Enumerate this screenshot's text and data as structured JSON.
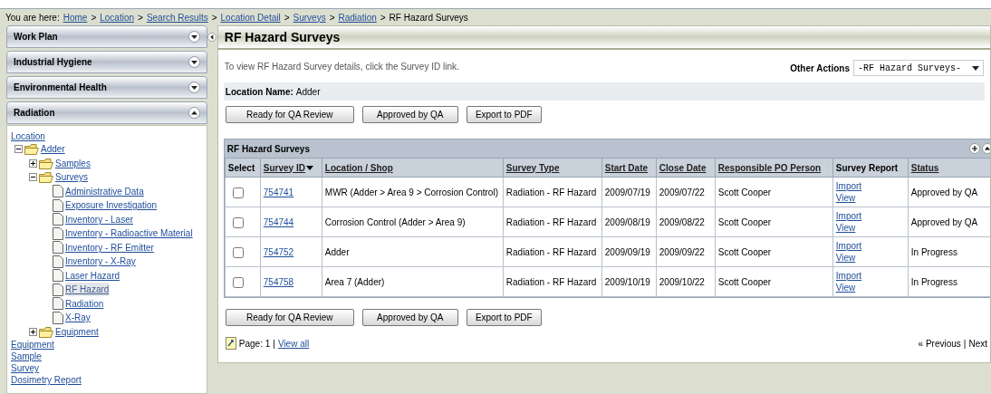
{
  "breadcrumb": {
    "prefix": "You are here:",
    "links": [
      "Home",
      "Location",
      "Search Results",
      "Location Detail",
      "Surveys",
      "Radiation"
    ],
    "separator": ">",
    "current": "RF Hazard Surveys"
  },
  "sidebar": {
    "panels": [
      {
        "label": "Work Plan",
        "expanded": false
      },
      {
        "label": "Industrial Hygiene",
        "expanded": false
      },
      {
        "label": "Environmental Health",
        "expanded": false
      },
      {
        "label": "Radiation",
        "expanded": true
      }
    ],
    "tree": {
      "root": "Location",
      "children": [
        {
          "label": "Adder",
          "kind": "folder",
          "expanded": true,
          "children": [
            {
              "label": "Samples",
              "kind": "folder",
              "expanded": false
            },
            {
              "label": "Surveys",
              "kind": "folder",
              "expanded": true,
              "children": [
                {
                  "label": "Administrative Data",
                  "kind": "page",
                  "selected": false
                },
                {
                  "label": "Exposure Investigation",
                  "kind": "page",
                  "selected": false
                },
                {
                  "label": "Inventory - Laser",
                  "kind": "page",
                  "selected": false
                },
                {
                  "label": "Inventory - Radioactive Material",
                  "kind": "page",
                  "selected": false
                },
                {
                  "label": "Inventory - RF Emitter",
                  "kind": "page",
                  "selected": false
                },
                {
                  "label": "Inventory - X-Ray",
                  "kind": "page",
                  "selected": false
                },
                {
                  "label": "Laser Hazard",
                  "kind": "page",
                  "selected": false
                },
                {
                  "label": "RF Hazard",
                  "kind": "page",
                  "selected": true
                },
                {
                  "label": "Radiation",
                  "kind": "page",
                  "selected": false
                },
                {
                  "label": "X-Ray",
                  "kind": "page",
                  "selected": false
                }
              ]
            },
            {
              "label": "Equipment",
              "kind": "folder",
              "expanded": false
            }
          ]
        }
      ]
    },
    "links": [
      "Equipment",
      "Sample",
      "Survey",
      "Dosimetry Report"
    ]
  },
  "main": {
    "title": "RF Hazard Surveys",
    "instructions": "To view RF Hazard Survey details, click the Survey ID link.",
    "other_actions": {
      "label": "Other Actions",
      "value": "-RF Hazard Surveys-"
    },
    "location_name": {
      "label": "Location Name:",
      "value": "Adder"
    },
    "buttons": [
      "Ready for QA Review",
      "Approved by QA",
      "Export to PDF"
    ],
    "table": {
      "title": "RF Hazard Surveys",
      "columns": [
        {
          "label": "Select",
          "sortable": false,
          "sorted": false
        },
        {
          "label": "Survey ID",
          "sortable": true,
          "sorted": true
        },
        {
          "label": "Location / Shop",
          "sortable": true,
          "sorted": false
        },
        {
          "label": "Survey Type",
          "sortable": true,
          "sorted": false
        },
        {
          "label": "Start Date",
          "sortable": true,
          "sorted": false
        },
        {
          "label": "Close Date",
          "sortable": true,
          "sorted": false
        },
        {
          "label": "Responsible PO Person",
          "sortable": true,
          "sorted": false
        },
        {
          "label": "Survey Report",
          "sortable": false,
          "sorted": false
        },
        {
          "label": "Status",
          "sortable": true,
          "sorted": false
        }
      ],
      "rows": [
        {
          "checked": false,
          "id": "754741",
          "location": "MWR (Adder > Area 9 > Corrosion Control)",
          "type": "Radiation - RF Hazard",
          "start": "2009/07/19",
          "close": "2009/07/22",
          "person": "Scott Cooper",
          "report_links": [
            "Import",
            "View"
          ],
          "status": "Approved by QA"
        },
        {
          "checked": false,
          "id": "754744",
          "location": "Corrosion Control (Adder > Area 9)",
          "type": "Radiation - RF Hazard",
          "start": "2009/08/19",
          "close": "2009/08/22",
          "person": "Scott Cooper",
          "report_links": [
            "Import",
            "View"
          ],
          "status": "Approved by QA"
        },
        {
          "checked": false,
          "id": "754752",
          "location": "Adder",
          "type": "Radiation - RF Hazard",
          "start": "2009/09/19",
          "close": "2009/09/22",
          "person": "Scott Cooper",
          "report_links": [
            "Import",
            "View"
          ],
          "status": "In Progress"
        },
        {
          "checked": false,
          "id": "754758",
          "location": "Area 7 (Adder)",
          "type": "Radiation - RF Hazard",
          "start": "2009/10/19",
          "close": "2009/10/22",
          "person": "Scott Cooper",
          "report_links": [
            "Import",
            "View"
          ],
          "status": "In Progress"
        }
      ]
    },
    "buttons_bottom": [
      "Ready for QA Review",
      "Approved by QA",
      "Export to PDF"
    ],
    "pagination": {
      "page": "Page: 1",
      "separator": "|",
      "view_all": "View all",
      "previous": "« Previous",
      "separator2": "|",
      "next": "Next"
    }
  }
}
